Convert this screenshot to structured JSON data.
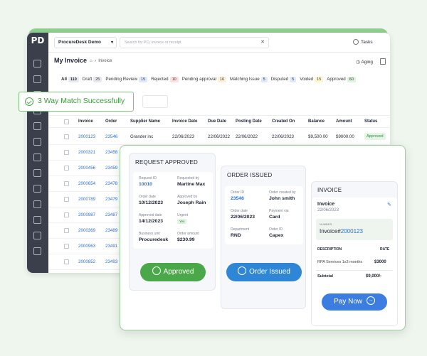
{
  "app": {
    "logo": "PD",
    "org": "ProcureDesk Demo",
    "search_placeholder": "Search for PO, invoice or receipt",
    "tasks": "Tasks",
    "page_title": "My Invoice",
    "breadcrumb": "Invoice",
    "aging": "Aging"
  },
  "tabs": [
    {
      "label": "All",
      "count": "110",
      "bg": "#e7e9ee"
    },
    {
      "label": "Draft",
      "count": "25",
      "bg": "#e7e9ee"
    },
    {
      "label": "Pending Review",
      "count": "15",
      "bg": "#dfe9fb"
    },
    {
      "label": "Rejected",
      "count": "10",
      "bg": "#fde1e1"
    },
    {
      "label": "Pending approval",
      "count": "16",
      "bg": "#fdf0d4"
    },
    {
      "label": "Matching Issue",
      "count": "5",
      "bg": "#dfe9fb"
    },
    {
      "label": "Disputed",
      "count": "5",
      "bg": "#dfe9fb"
    },
    {
      "label": "Voided",
      "count": "15",
      "bg": "#fdf6cf"
    },
    {
      "label": "Approved",
      "count": "60",
      "bg": "#dff3df"
    }
  ],
  "table": {
    "headers": [
      "Invoice",
      "Order",
      "Supplier Name",
      "Invoice Date",
      "Due Date",
      "Posting Date",
      "Created On",
      "Balance",
      "Amount",
      "Status"
    ],
    "rows": [
      {
        "invoice": "2000123",
        "order": "23546",
        "supplier": "Grander inc",
        "invoice_date": "22/06/2023",
        "due_date": "22/06/2022",
        "posting_date": "22/06/2022",
        "created": "22/06/2023",
        "balance": "$9,500.00",
        "amount": "$9000.00",
        "status": "Approved"
      },
      {
        "invoice": "2000321",
        "order": "23458"
      },
      {
        "invoice": "2000456",
        "order": "23459"
      },
      {
        "invoice": "2000654",
        "order": "23478"
      },
      {
        "invoice": "2000789",
        "order": "23479"
      },
      {
        "invoice": "2000987",
        "order": "23487"
      },
      {
        "invoice": "2000369",
        "order": "23489"
      },
      {
        "invoice": "2000963",
        "order": "23491"
      },
      {
        "invoice": "2000852",
        "order": "23493"
      }
    ]
  },
  "toast": "3 Way Match Successfully",
  "request": {
    "title": "REQUEST APPROVED",
    "request_id_label": "Request ID",
    "request_id": "10010",
    "requested_by_label": "Requested by",
    "requested_by": "Martine Max",
    "order_date_label": "Order date",
    "order_date": "10/12/2023",
    "approved_by_label": "Approved by",
    "approved_by": "Joseph Rain",
    "approved_date_label": "Approved date",
    "approved_date": "14/12/2023",
    "urgent_label": "Urgent",
    "urgent": "Yes",
    "business_unit_label": "Business unit",
    "business_unit": "Procuredesk",
    "order_amount_label": "Order amount",
    "order_amount": "$230.99",
    "button": "Approved"
  },
  "order": {
    "title": "ORDER ISSUED",
    "order_id_label": "Order ID",
    "order_id": "23546",
    "created_by_label": "Order created by",
    "created_by": "John smith",
    "order_date_label": "Order date",
    "order_date": "22/06/2023",
    "payment_label": "Payment via",
    "payment": "Card",
    "department_label": "Department",
    "department": "RND",
    "order_id2_label": "Order ID",
    "order_id2": "Capex",
    "button": "Order Issued"
  },
  "invoice": {
    "title": "INVOICE",
    "heading": "Invoice",
    "date": "22/06/2023",
    "number_label": "NUMBER",
    "number_prefix": "Invoice#",
    "number": "2000123",
    "desc_header": "DESCRIPTION",
    "rate_header": "RATE",
    "item": "RPA Services 1x3 months",
    "item_rate": "$3000",
    "subtotal_label": "Subtotal",
    "subtotal": "$9,000/-",
    "button": "Pay Now"
  },
  "colors": {
    "green": "#4aa84a",
    "blue": "#2f86d6",
    "pay": "#3b7de0",
    "sidebar": "#3a3f4b"
  }
}
